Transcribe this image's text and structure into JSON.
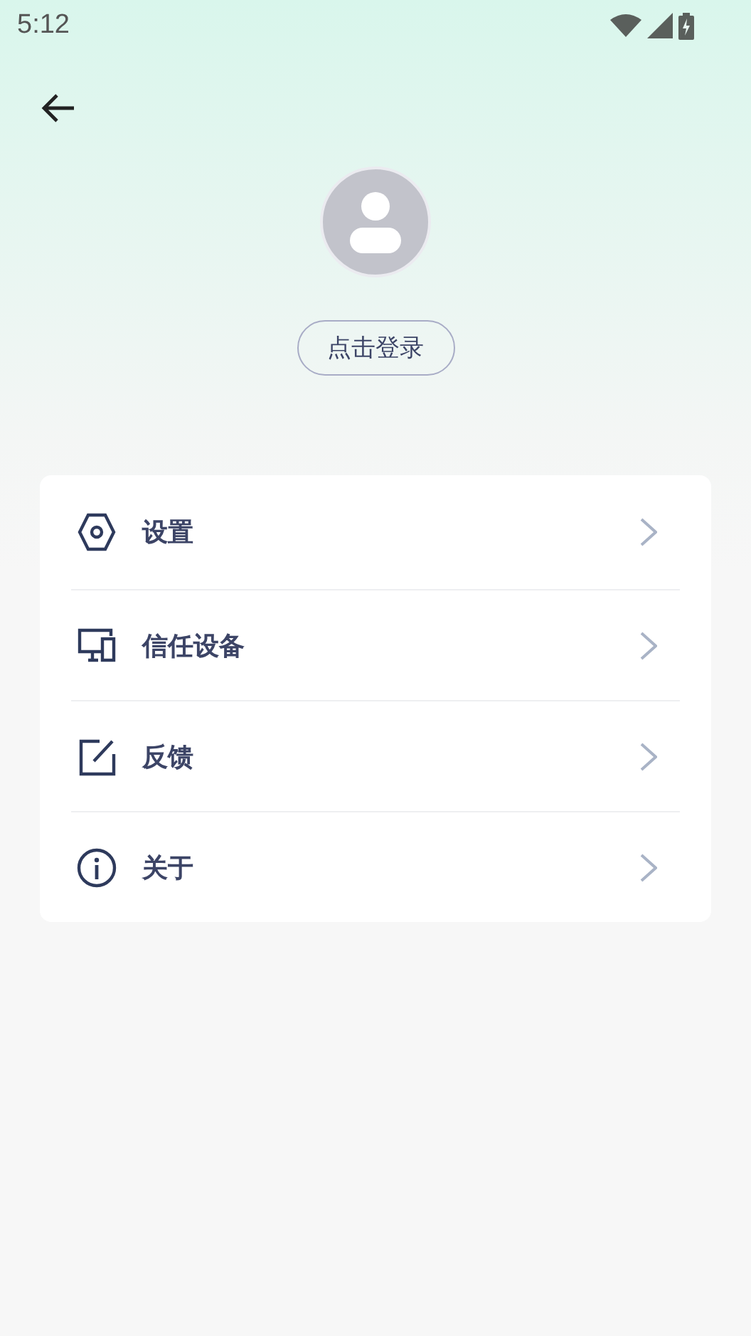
{
  "status_bar": {
    "time": "5:12"
  },
  "login_button": {
    "label": "点击登录"
  },
  "menu": [
    {
      "kind": "settings",
      "label": "设置"
    },
    {
      "kind": "devices",
      "label": "信任设备"
    },
    {
      "kind": "feedback",
      "label": "反馈"
    },
    {
      "kind": "about",
      "label": "关于"
    }
  ]
}
